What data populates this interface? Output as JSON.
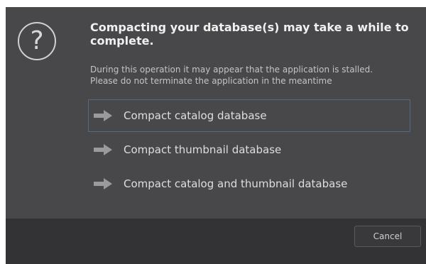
{
  "dialog": {
    "icon": "question-icon",
    "title": "Compacting your database(s) may take a while to complete.",
    "description_line1": "During this operation it may appear that the application is stalled.",
    "description_line2": "Please do not terminate the application in the meantime",
    "options": [
      {
        "icon": "arrow-right-icon",
        "label": "Compact catalog database",
        "focused": true
      },
      {
        "icon": "arrow-right-icon",
        "label": "Compact thumbnail database",
        "focused": false
      },
      {
        "icon": "arrow-right-icon",
        "label": "Compact catalog and thumbnail database",
        "focused": false
      }
    ],
    "cancel_label": "Cancel"
  },
  "colors": {
    "background": "#48484a",
    "footer": "#333335",
    "arrow": "#9a9a9a",
    "focus_border": "#566a84"
  }
}
